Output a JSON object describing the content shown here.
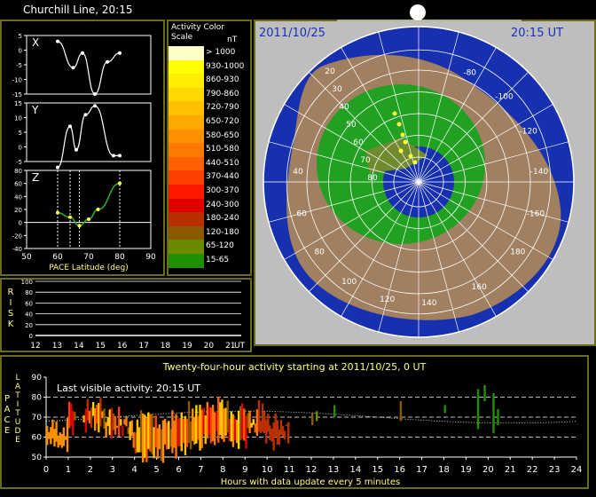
{
  "churchill": {
    "title": "Churchill Line, 20:15",
    "x_label": "X",
    "x_ticks": [
      "5",
      "0",
      "-5",
      "-10",
      "-15"
    ],
    "x_points": [
      [
        60,
        3
      ],
      [
        65,
        -6
      ],
      [
        68,
        -1
      ],
      [
        72,
        -15
      ],
      [
        76,
        -4
      ],
      [
        80,
        -1
      ]
    ],
    "y_label": "Y",
    "y_ticks": [
      "15",
      "10",
      "5",
      "0",
      "-5"
    ],
    "y_points": [
      [
        60,
        -7
      ],
      [
        64,
        7
      ],
      [
        66,
        -1
      ],
      [
        69,
        11
      ],
      [
        72,
        14
      ],
      [
        78,
        -3
      ],
      [
        80,
        -3
      ]
    ],
    "z_label": "Z",
    "z_ticks": [
      "80",
      "60",
      "40",
      "20",
      "0",
      "-20",
      "-40"
    ],
    "z_points": [
      [
        60,
        15
      ],
      [
        64,
        8
      ],
      [
        67,
        -5
      ],
      [
        70,
        5
      ],
      [
        73,
        20
      ],
      [
        80,
        60
      ]
    ],
    "x_axis_ticks": [
      "50",
      "60",
      "70",
      "80",
      "90"
    ],
    "xlabel": "PACE Latitude (deg)"
  },
  "scale": {
    "title": "Activity Color Scale",
    "unit": "nT",
    "entries": [
      {
        "label": "> 1000",
        "color": "#ffffc8"
      },
      {
        "label": "930-1000",
        "color": "#ffff00"
      },
      {
        "label": "860-930",
        "color": "#ffee00"
      },
      {
        "label": "790-860",
        "color": "#ffd800"
      },
      {
        "label": "720-790",
        "color": "#ffc000"
      },
      {
        "label": "650-720",
        "color": "#ffa800"
      },
      {
        "label": "580-650",
        "color": "#ff9000"
      },
      {
        "label": "510-580",
        "color": "#ff7800"
      },
      {
        "label": "440-510",
        "color": "#ff6000"
      },
      {
        "label": "370-440",
        "color": "#ff4000"
      },
      {
        "label": "300-370",
        "color": "#ff1800"
      },
      {
        "label": "240-300",
        "color": "#e00000"
      },
      {
        "label": "180-240",
        "color": "#b83000"
      },
      {
        "label": "120-180",
        "color": "#8a5a00"
      },
      {
        "label": "65-120",
        "color": "#6a8a00"
      },
      {
        "label": "15-65",
        "color": "#209000"
      }
    ]
  },
  "risk": {
    "label": "RISK",
    "y_ticks": [
      "100",
      "80",
      "60",
      "40",
      "20",
      "0"
    ],
    "x_ticks": [
      "12",
      "13",
      "14",
      "15",
      "16",
      "17",
      "18",
      "19",
      "20",
      "21"
    ],
    "x_unit": "UT"
  },
  "map": {
    "date": "2011/10/25",
    "time": "20:15 UT",
    "lat_labels": [
      "20",
      "30",
      "40",
      "50",
      "60",
      "70",
      "80"
    ],
    "lon_labels": [
      "-80",
      "-100",
      "-120",
      "-140",
      "-160",
      "180",
      "160",
      "140",
      "120",
      "100",
      "80",
      "60",
      "40"
    ],
    "colors": {
      "ocean": "#1630b0",
      "land": "#a08060",
      "night": "#bebebe",
      "oval": "#22a022",
      "grid": "#ffffff",
      "hi": "#ffff40"
    }
  },
  "activity": {
    "title": "Twenty-four-hour activity starting at 2011/10/25, 0 UT",
    "last_visible": "Last visible activity: 20:15 UT",
    "ylabel_a": "LATITUDE",
    "ylabel_b": "PACE",
    "y_ticks": [
      "90",
      "80",
      "70",
      "60",
      "50"
    ],
    "x_ticks": [
      "0",
      "1",
      "2",
      "3",
      "4",
      "5",
      "6",
      "7",
      "8",
      "9",
      "10",
      "11",
      "12",
      "13",
      "14",
      "15",
      "16",
      "17",
      "18",
      "19",
      "20",
      "21",
      "22",
      "23",
      "24"
    ],
    "xlabel": "Hours with data update every 5  minutes"
  },
  "chart_data": [
    {
      "type": "line",
      "title": "Churchill Line, 20:15",
      "xlabel": "PACE Latitude (deg)",
      "xlim": [
        50,
        90
      ],
      "series": [
        {
          "name": "X",
          "x": [
            60,
            65,
            68,
            72,
            76,
            80
          ],
          "y": [
            3,
            -6,
            -1,
            -15,
            -4,
            -1
          ]
        },
        {
          "name": "Y",
          "x": [
            60,
            64,
            66,
            69,
            72,
            78,
            80
          ],
          "y": [
            -7,
            7,
            -1,
            11,
            14,
            -3,
            -3
          ]
        },
        {
          "name": "Z",
          "x": [
            60,
            64,
            67,
            70,
            73,
            80
          ],
          "y": [
            15,
            8,
            -5,
            5,
            20,
            60
          ]
        }
      ]
    },
    {
      "type": "bar",
      "title": "Twenty-four-hour activity starting at 2011/10/25, 0 UT",
      "xlabel": "Hours with data update every 5  minutes",
      "ylabel": "PACE LATITUDE",
      "xlim": [
        0,
        24
      ],
      "ylim": [
        50,
        90
      ]
    }
  ]
}
